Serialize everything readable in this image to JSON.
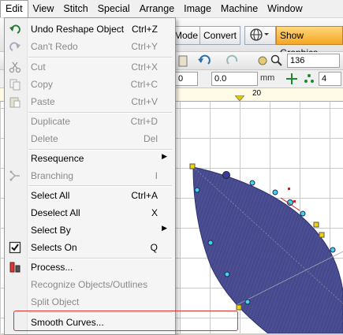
{
  "menubar": [
    "Edit",
    "View",
    "Stitch",
    "Special",
    "Arrange",
    "Image",
    "Machine",
    "Window"
  ],
  "toolbar": {
    "mode_label": "Mode",
    "convert_label": "Convert",
    "show_graphics_label": "Show Graphics",
    "zoom_value": "136",
    "field_a": "0",
    "field_b": "0.0",
    "unit": "mm",
    "field_c": "4",
    "ruler_label": "20"
  },
  "edit_menu": [
    {
      "label": "Undo Reshape Object",
      "shortcut": "Ctrl+Z",
      "enabled": true,
      "icon": "undo-icon"
    },
    {
      "label": "Can't Redo",
      "shortcut": "Ctrl+Y",
      "enabled": false,
      "icon": "redo-icon"
    },
    {
      "label": "Cut",
      "shortcut": "Ctrl+X",
      "enabled": false,
      "icon": "scissors-icon"
    },
    {
      "label": "Copy",
      "shortcut": "Ctrl+C",
      "enabled": false,
      "icon": "copy-icon"
    },
    {
      "label": "Paste",
      "shortcut": "Ctrl+V",
      "enabled": false,
      "icon": "paste-icon"
    },
    {
      "label": "Duplicate",
      "shortcut": "Ctrl+D",
      "enabled": false
    },
    {
      "label": "Delete",
      "shortcut": "Del",
      "enabled": false
    },
    {
      "label": "Resequence",
      "shortcut": "",
      "enabled": true,
      "submenu": true
    },
    {
      "label": "Branching",
      "shortcut": "I",
      "enabled": false,
      "icon": "branching-icon"
    },
    {
      "label": "Select All",
      "shortcut": "Ctrl+A",
      "enabled": true
    },
    {
      "label": "Deselect All",
      "shortcut": "X",
      "enabled": true
    },
    {
      "label": "Select By",
      "shortcut": "",
      "enabled": true,
      "submenu": true
    },
    {
      "label": "Selects On",
      "shortcut": "Q",
      "enabled": true,
      "icon": "checkbox-checked-icon"
    },
    {
      "label": "Process...",
      "shortcut": "",
      "enabled": true,
      "icon": "process-icon"
    },
    {
      "label": "Recognize Objects/Outlines",
      "shortcut": "",
      "enabled": false
    },
    {
      "label": "Split Object",
      "shortcut": "",
      "enabled": false
    },
    {
      "label": "Smooth Curves...",
      "shortcut": "",
      "enabled": true
    }
  ],
  "colors": {
    "leaf_fill": "#4b4e93",
    "highlight_box": "#d93030",
    "accent_orange": "#f5a623"
  }
}
